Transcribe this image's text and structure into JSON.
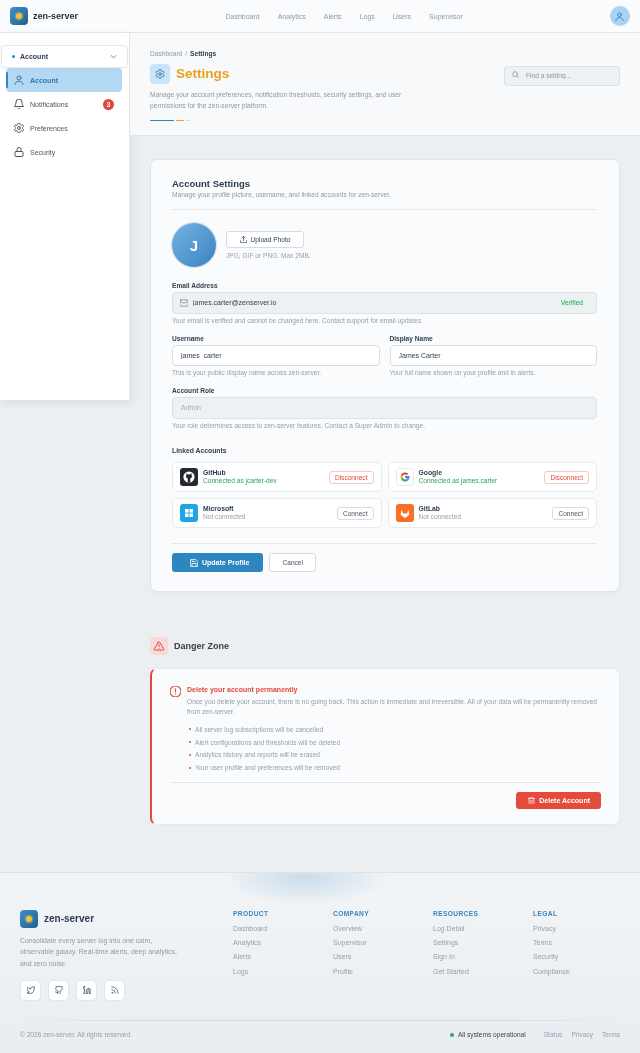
{
  "header": {
    "brand": "zen-server",
    "nav": [
      {
        "label": "Dashboard",
        "selected": false
      },
      {
        "label": "Analytics",
        "selected": false
      },
      {
        "label": "Alerts",
        "selected": false
      },
      {
        "label": "Logs",
        "selected": false
      },
      {
        "label": "Users",
        "selected": false
      },
      {
        "label": "Supervisor",
        "selected": false
      }
    ]
  },
  "sidebar": {
    "section": {
      "label": "Account",
      "expanded": true
    },
    "items": [
      {
        "label": "Account",
        "selected": true
      },
      {
        "label": "Notifications",
        "selected": false,
        "badge": "3"
      },
      {
        "label": "Preferences",
        "selected": false
      },
      {
        "label": "Security",
        "selected": false
      }
    ]
  },
  "page_header": {
    "breadcrumb": [
      {
        "label": "Dashboard",
        "current": false
      },
      {
        "label": "Settings",
        "current": true
      }
    ],
    "separator": "/",
    "title": "Settings",
    "description": "Manage your account preferences, notification thresholds, security settings, and user permissions for the zen-server platform.",
    "search": {
      "placeholder": "Find a setting..."
    }
  },
  "account_settings": {
    "title": "Account Settings",
    "subtitle": "Manage your profile picture, username, and linked accounts for zen-server.",
    "avatar_initial": "J",
    "upload_button": "Upload Photo",
    "upload_hint": "JPG, GIF or PNG. Max 2MB.",
    "field_rows": [
      {
        "fields": [
          {
            "kind": "email",
            "label": "Email Address",
            "value": "james.carter@zenserver.io",
            "badge": "Verified",
            "hint": "Your email is verified and cannot be changed here. Contact support for email updates.",
            "readonly": true,
            "disabled": false
          }
        ]
      },
      {
        "fields": [
          {
            "kind": "text",
            "label": "Username",
            "value": "james_carter",
            "hint": "This is your public display name across zen-server.",
            "readonly": false,
            "disabled": false
          },
          {
            "kind": "text",
            "label": "Display Name",
            "value": "James Carter",
            "hint": "Your full name shown on your profile and in alerts.",
            "readonly": false,
            "disabled": false
          }
        ]
      },
      {
        "fields": [
          {
            "kind": "text",
            "label": "Account Role",
            "value": "Admin",
            "hint": "Your role determines access to zen-server features. Contact a Super Admin to change.",
            "readonly": true,
            "disabled": true
          }
        ]
      }
    ],
    "linked_accounts": {
      "title": "Linked Accounts",
      "items": [
        {
          "name": "GitHub",
          "status": "Connected as jcarter-dev",
          "connected": true,
          "action": "Disconnect"
        },
        {
          "name": "Google",
          "status": "Connected as james.carter",
          "connected": true,
          "action": "Disconnect"
        },
        {
          "name": "Microsoft",
          "status": "Not connected",
          "connected": false,
          "action": "Connect"
        },
        {
          "name": "GitLab",
          "status": "Not connected",
          "connected": false,
          "action": "Connect"
        }
      ]
    },
    "buttons": [
      {
        "label": "Update Profile",
        "kind": "primary"
      },
      {
        "label": "Cancel",
        "kind": "secondary"
      }
    ]
  },
  "danger_zone": {
    "title": "Danger Zone",
    "warning_title": "Delete your account permanently",
    "description": "Once you delete your account, there is no going back. This action is immediate and irreversible. All of your data will be permanently removed from zen-server.",
    "consequences": [
      "All server log subscriptions will be cancelled",
      "Alert configurations and thresholds will be deleted",
      "Analytics history and reports will be erased",
      "Your user profile and preferences will be removed"
    ],
    "button": "Delete Account"
  },
  "footer": {
    "brand": "zen-server",
    "description": "Consolidate every server log into one calm, observable galaxy. Real-time alerts, deep analytics, and zero noise.",
    "columns": [
      {
        "title": "PRODUCT",
        "links": [
          "Dashboard",
          "Analytics",
          "Alerts",
          "Logs"
        ]
      },
      {
        "title": "COMPANY",
        "links": [
          "Overview",
          "Supervisor",
          "Users",
          "Profile"
        ]
      },
      {
        "title": "RESOURCES",
        "links": [
          "Log Detail",
          "Settings",
          "Sign In",
          "Get Started"
        ]
      },
      {
        "title": "LEGAL",
        "links": [
          "Privacy",
          "Terms",
          "Security",
          "Compliance"
        ]
      }
    ],
    "copyright": "© 2026 zen-server. All rights reserved.",
    "status": {
      "label": "All systems operational",
      "operational": true
    },
    "links": [
      "Status",
      "Privacy",
      "Terms"
    ]
  }
}
